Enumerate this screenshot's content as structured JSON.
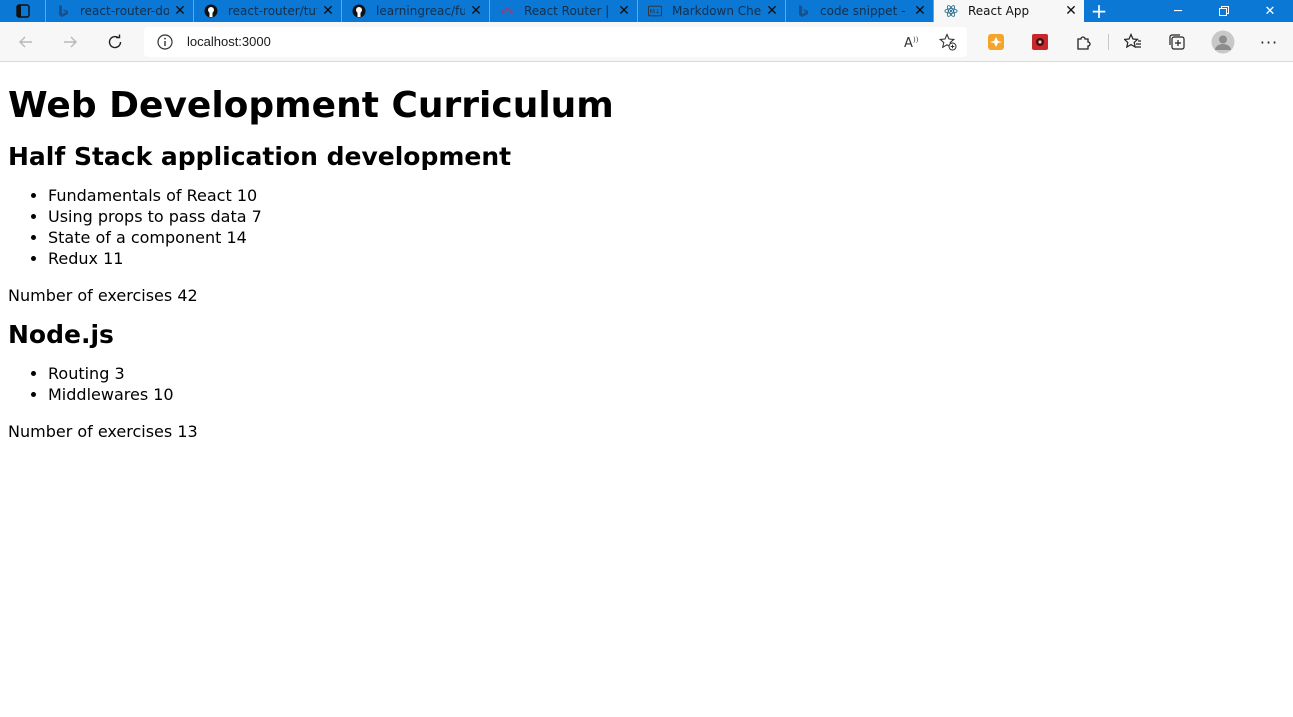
{
  "browser": {
    "tabs": [
      {
        "title": "react-router-do",
        "icon": "bing-icon"
      },
      {
        "title": "react-router/tut",
        "icon": "github-icon"
      },
      {
        "title": "learningreac/fu",
        "icon": "github-icon"
      },
      {
        "title": "React Router | E",
        "icon": "react-router-icon"
      },
      {
        "title": "Markdown Che",
        "icon": "markdown-icon"
      },
      {
        "title": "code snippet -",
        "icon": "bing-icon"
      },
      {
        "title": "React App",
        "icon": "react-icon",
        "active": true
      }
    ],
    "address": "localhost:3000"
  },
  "page": {
    "heading": "Web Development Curriculum",
    "courses": [
      {
        "name": "Half Stack application development",
        "parts": [
          {
            "name": "Fundamentals of React",
            "exercises": 10
          },
          {
            "name": "Using props to pass data",
            "exercises": 7
          },
          {
            "name": "State of a component",
            "exercises": 14
          },
          {
            "name": "Redux",
            "exercises": 11
          }
        ],
        "total_text": "Number of exercises 42"
      },
      {
        "name": "Node.js",
        "parts": [
          {
            "name": "Routing",
            "exercises": 3
          },
          {
            "name": "Middlewares",
            "exercises": 10
          }
        ],
        "total_text": "Number of exercises 13"
      }
    ]
  },
  "colors": {
    "tabstrip": "#0a78d4",
    "toolbar": "#f7f7f7"
  }
}
